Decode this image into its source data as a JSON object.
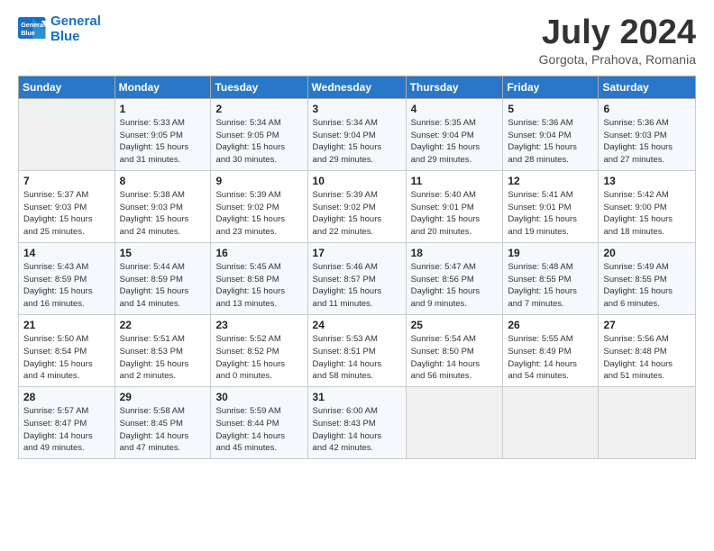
{
  "header": {
    "logo_line1": "General",
    "logo_line2": "Blue",
    "month": "July 2024",
    "location": "Gorgota, Prahova, Romania"
  },
  "weekdays": [
    "Sunday",
    "Monday",
    "Tuesday",
    "Wednesday",
    "Thursday",
    "Friday",
    "Saturday"
  ],
  "weeks": [
    [
      {
        "day": "",
        "info": ""
      },
      {
        "day": "1",
        "info": "Sunrise: 5:33 AM\nSunset: 9:05 PM\nDaylight: 15 hours\nand 31 minutes."
      },
      {
        "day": "2",
        "info": "Sunrise: 5:34 AM\nSunset: 9:05 PM\nDaylight: 15 hours\nand 30 minutes."
      },
      {
        "day": "3",
        "info": "Sunrise: 5:34 AM\nSunset: 9:04 PM\nDaylight: 15 hours\nand 29 minutes."
      },
      {
        "day": "4",
        "info": "Sunrise: 5:35 AM\nSunset: 9:04 PM\nDaylight: 15 hours\nand 29 minutes."
      },
      {
        "day": "5",
        "info": "Sunrise: 5:36 AM\nSunset: 9:04 PM\nDaylight: 15 hours\nand 28 minutes."
      },
      {
        "day": "6",
        "info": "Sunrise: 5:36 AM\nSunset: 9:03 PM\nDaylight: 15 hours\nand 27 minutes."
      }
    ],
    [
      {
        "day": "7",
        "info": "Sunrise: 5:37 AM\nSunset: 9:03 PM\nDaylight: 15 hours\nand 25 minutes."
      },
      {
        "day": "8",
        "info": "Sunrise: 5:38 AM\nSunset: 9:03 PM\nDaylight: 15 hours\nand 24 minutes."
      },
      {
        "day": "9",
        "info": "Sunrise: 5:39 AM\nSunset: 9:02 PM\nDaylight: 15 hours\nand 23 minutes."
      },
      {
        "day": "10",
        "info": "Sunrise: 5:39 AM\nSunset: 9:02 PM\nDaylight: 15 hours\nand 22 minutes."
      },
      {
        "day": "11",
        "info": "Sunrise: 5:40 AM\nSunset: 9:01 PM\nDaylight: 15 hours\nand 20 minutes."
      },
      {
        "day": "12",
        "info": "Sunrise: 5:41 AM\nSunset: 9:01 PM\nDaylight: 15 hours\nand 19 minutes."
      },
      {
        "day": "13",
        "info": "Sunrise: 5:42 AM\nSunset: 9:00 PM\nDaylight: 15 hours\nand 18 minutes."
      }
    ],
    [
      {
        "day": "14",
        "info": "Sunrise: 5:43 AM\nSunset: 8:59 PM\nDaylight: 15 hours\nand 16 minutes."
      },
      {
        "day": "15",
        "info": "Sunrise: 5:44 AM\nSunset: 8:59 PM\nDaylight: 15 hours\nand 14 minutes."
      },
      {
        "day": "16",
        "info": "Sunrise: 5:45 AM\nSunset: 8:58 PM\nDaylight: 15 hours\nand 13 minutes."
      },
      {
        "day": "17",
        "info": "Sunrise: 5:46 AM\nSunset: 8:57 PM\nDaylight: 15 hours\nand 11 minutes."
      },
      {
        "day": "18",
        "info": "Sunrise: 5:47 AM\nSunset: 8:56 PM\nDaylight: 15 hours\nand 9 minutes."
      },
      {
        "day": "19",
        "info": "Sunrise: 5:48 AM\nSunset: 8:55 PM\nDaylight: 15 hours\nand 7 minutes."
      },
      {
        "day": "20",
        "info": "Sunrise: 5:49 AM\nSunset: 8:55 PM\nDaylight: 15 hours\nand 6 minutes."
      }
    ],
    [
      {
        "day": "21",
        "info": "Sunrise: 5:50 AM\nSunset: 8:54 PM\nDaylight: 15 hours\nand 4 minutes."
      },
      {
        "day": "22",
        "info": "Sunrise: 5:51 AM\nSunset: 8:53 PM\nDaylight: 15 hours\nand 2 minutes."
      },
      {
        "day": "23",
        "info": "Sunrise: 5:52 AM\nSunset: 8:52 PM\nDaylight: 15 hours\nand 0 minutes."
      },
      {
        "day": "24",
        "info": "Sunrise: 5:53 AM\nSunset: 8:51 PM\nDaylight: 14 hours\nand 58 minutes."
      },
      {
        "day": "25",
        "info": "Sunrise: 5:54 AM\nSunset: 8:50 PM\nDaylight: 14 hours\nand 56 minutes."
      },
      {
        "day": "26",
        "info": "Sunrise: 5:55 AM\nSunset: 8:49 PM\nDaylight: 14 hours\nand 54 minutes."
      },
      {
        "day": "27",
        "info": "Sunrise: 5:56 AM\nSunset: 8:48 PM\nDaylight: 14 hours\nand 51 minutes."
      }
    ],
    [
      {
        "day": "28",
        "info": "Sunrise: 5:57 AM\nSunset: 8:47 PM\nDaylight: 14 hours\nand 49 minutes."
      },
      {
        "day": "29",
        "info": "Sunrise: 5:58 AM\nSunset: 8:45 PM\nDaylight: 14 hours\nand 47 minutes."
      },
      {
        "day": "30",
        "info": "Sunrise: 5:59 AM\nSunset: 8:44 PM\nDaylight: 14 hours\nand 45 minutes."
      },
      {
        "day": "31",
        "info": "Sunrise: 6:00 AM\nSunset: 8:43 PM\nDaylight: 14 hours\nand 42 minutes."
      },
      {
        "day": "",
        "info": ""
      },
      {
        "day": "",
        "info": ""
      },
      {
        "day": "",
        "info": ""
      }
    ]
  ]
}
